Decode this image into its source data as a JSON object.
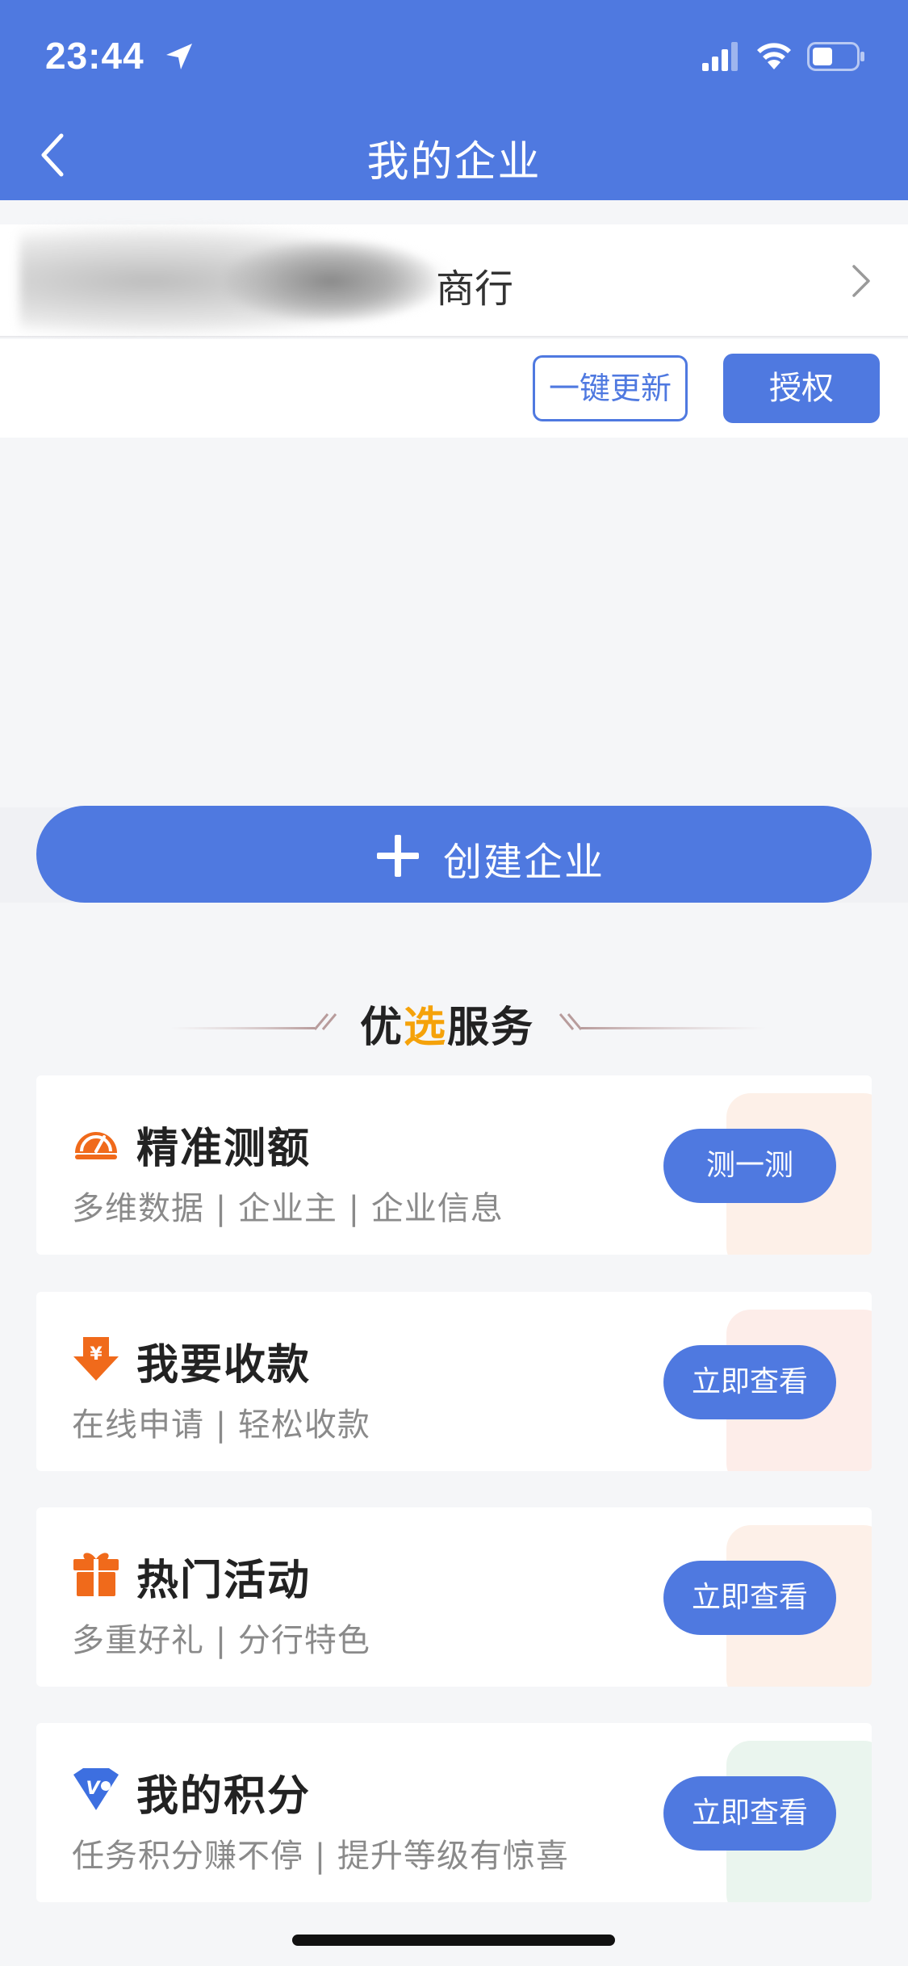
{
  "status_bar": {
    "time": "23:44"
  },
  "nav": {
    "title": "我的企业"
  },
  "company": {
    "name_visible": "商行"
  },
  "actions": {
    "update_label": "一键更新",
    "authorize_label": "授权"
  },
  "create": {
    "label": "创建企业"
  },
  "section": {
    "title_part1": "优",
    "title_highlight": "选",
    "title_part2": "服务"
  },
  "services": [
    {
      "icon": "gauge-icon",
      "title": "精准测额",
      "subtitle": "多维数据 | 企业主 | 企业信息",
      "button": "测一测"
    },
    {
      "icon": "yuan-arrow-icon",
      "title": "我要收款",
      "subtitle": "在线申请 | 轻松收款",
      "button": "立即查看"
    },
    {
      "icon": "gift-icon",
      "title": "热门活动",
      "subtitle": "多重好礼 | 分行特色",
      "button": "立即查看"
    },
    {
      "icon": "vip-badge-icon",
      "title": "我的积分",
      "subtitle": "任务积分赚不停 | 提升等级有惊喜",
      "button": "立即查看"
    }
  ],
  "colors": {
    "primary": "#4f79e0",
    "accent_orange": "#f5a20a",
    "icon_orange": "#f06a1b",
    "page_bg": "#f5f6f8"
  }
}
